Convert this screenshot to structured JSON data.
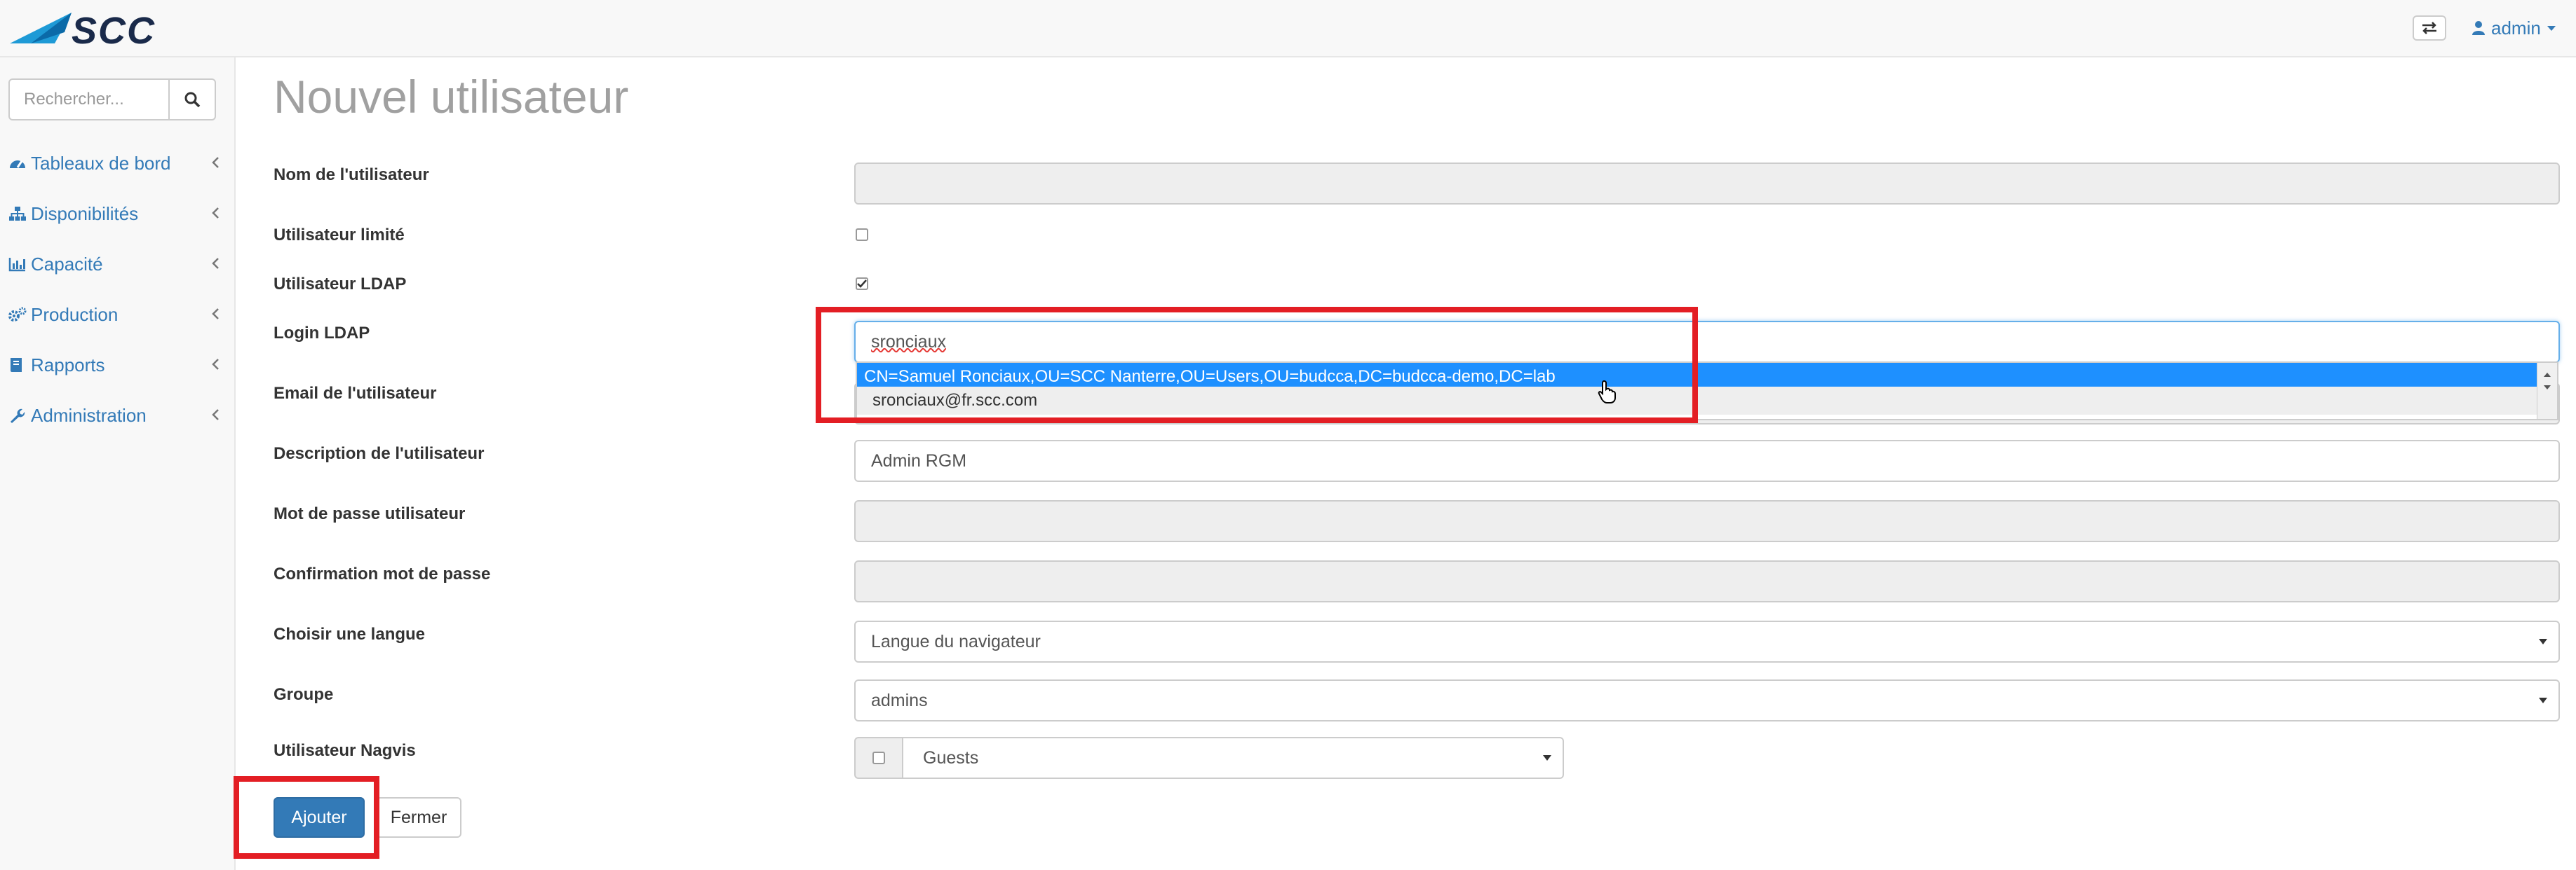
{
  "header": {
    "user_label": "admin"
  },
  "sidebar": {
    "search_placeholder": "Rechercher...",
    "items": [
      {
        "label": "Tableaux de bord",
        "icon": "dashboard-icon"
      },
      {
        "label": "Disponibilités",
        "icon": "sitemap-icon"
      },
      {
        "label": "Capacité",
        "icon": "bar-chart-icon"
      },
      {
        "label": "Production",
        "icon": "gears-icon"
      },
      {
        "label": "Rapports",
        "icon": "book-icon"
      },
      {
        "label": "Administration",
        "icon": "wrench-icon"
      }
    ]
  },
  "form": {
    "title": "Nouvel utilisateur",
    "labels": {
      "username": "Nom de l'utilisateur",
      "limited": "Utilisateur limité",
      "ldap": "Utilisateur LDAP",
      "ldap_login": "Login LDAP",
      "email": "Email de l'utilisateur",
      "description": "Description de l'utilisateur",
      "password": "Mot de passe utilisateur",
      "password_confirm": "Confirmation mot de passe",
      "language": "Choisir une langue",
      "group": "Groupe",
      "nagvis": "Utilisateur Nagvis"
    },
    "values": {
      "username": "",
      "limited_checked": false,
      "ldap_checked": true,
      "ldap_login": "sronciaux",
      "email": "sronciaux@fr.scc.com",
      "description": "Admin RGM",
      "password": "",
      "password_confirm": "",
      "language": "Langue du navigateur",
      "group": "admins",
      "nagvis_checked": false,
      "nagvis_group": "Guests"
    },
    "autocomplete": [
      "CN=Samuel Ronciaux,OU=SCC Nanterre,OU=Users,OU=budcca,DC=budcca-demo,DC=lab"
    ],
    "buttons": {
      "submit": "Ajouter",
      "close": "Fermer"
    }
  },
  "colors": {
    "accent": "#337ab7",
    "highlight_box": "#e31e24",
    "autocomplete_selected": "#1e90ff",
    "title": "#a0a0a0"
  }
}
